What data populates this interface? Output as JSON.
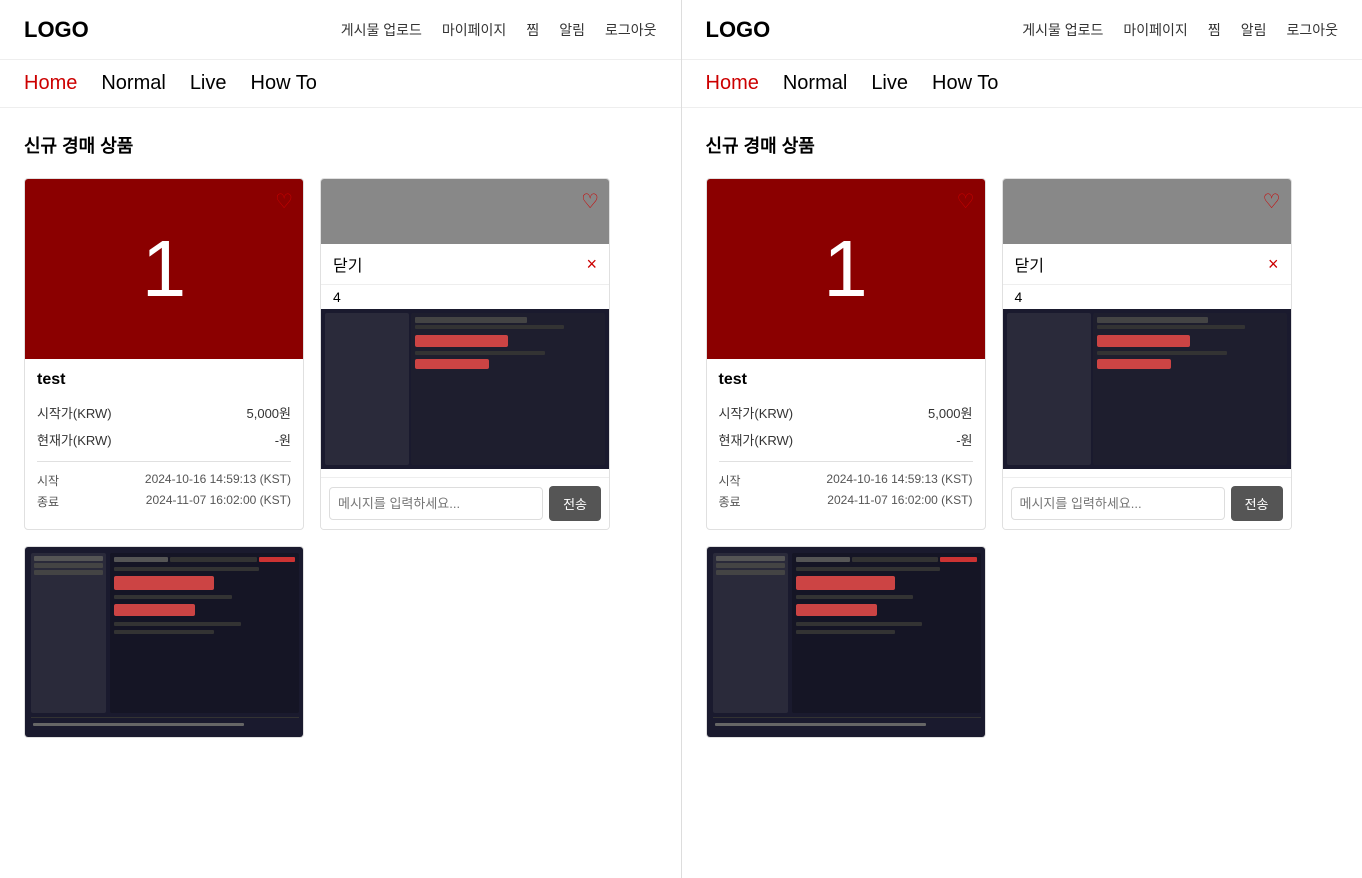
{
  "panels": [
    {
      "logo": "LOGO",
      "header_nav": [
        "게시물 업로드",
        "마이페이지",
        "찜",
        "알림",
        "로그아웃"
      ],
      "nav_tabs": [
        {
          "label": "Home",
          "active": true
        },
        {
          "label": "Normal",
          "active": false
        },
        {
          "label": "Live",
          "active": false
        },
        {
          "label": "How To",
          "active": false
        }
      ],
      "section_title": "신규 경매 상품",
      "cards": [
        {
          "type": "numbered",
          "number": "1",
          "title": "test",
          "start_price_label": "시작가(KRW)",
          "start_price_value": "5,000원",
          "current_price_label": "현재가(KRW)",
          "current_price_value": "-원",
          "start_label": "시작",
          "start_date": "2024-10-16 14:59:13 (KST)",
          "end_label": "종료",
          "end_date": "2024-11-07 16:02:00 (KST)"
        }
      ],
      "chat": {
        "close_label": "닫기",
        "close_icon": "×",
        "number": "4",
        "input_placeholder": "메시지를 입력하세요...",
        "send_label": "전송"
      }
    },
    {
      "logo": "LOGO",
      "header_nav": [
        "게시물 업로드",
        "마이페이지",
        "찜",
        "알림",
        "로그아웃"
      ],
      "nav_tabs": [
        {
          "label": "Home",
          "active": true
        },
        {
          "label": "Normal",
          "active": false
        },
        {
          "label": "Live",
          "active": false
        },
        {
          "label": "How To",
          "active": false
        }
      ],
      "section_title": "신규 경매 상품",
      "cards": [
        {
          "type": "numbered",
          "number": "1",
          "title": "test",
          "start_price_label": "시작가(KRW)",
          "start_price_value": "5,000원",
          "current_price_label": "현재가(KRW)",
          "current_price_value": "-원",
          "start_label": "시작",
          "start_date": "2024-10-16 14:59:13 (KST)",
          "end_label": "종료",
          "end_date": "2024-11-07 16:02:00 (KST)"
        }
      ],
      "chat": {
        "close_label": "닫기",
        "close_icon": "×",
        "number": "4",
        "input_placeholder": "메시지를 입력하세요...",
        "send_label": "전송"
      }
    }
  ],
  "accent_color": "#cc0000",
  "dark_red": "#8b0000"
}
